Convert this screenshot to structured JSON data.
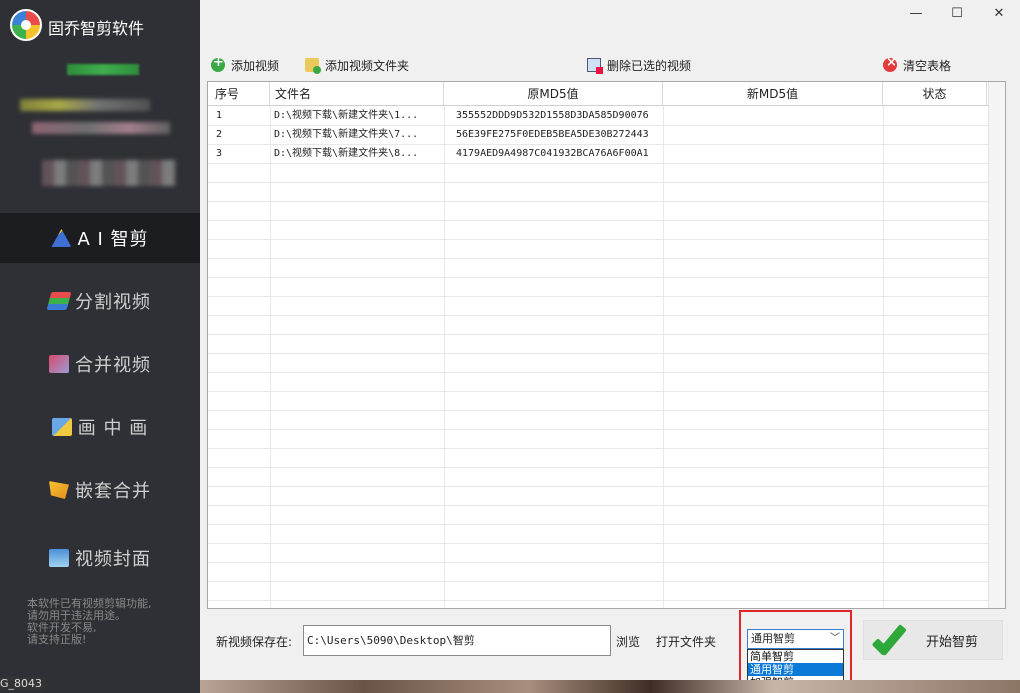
{
  "app": {
    "title": "固乔智剪软件"
  },
  "window_controls": {
    "minimize": "—",
    "maximize": "☐",
    "close": "✕"
  },
  "sidebar": {
    "items": [
      {
        "label": "A I 智剪",
        "icon": "ai-wand-icon",
        "active": true
      },
      {
        "label": "分割视频",
        "icon": "split-video-icon"
      },
      {
        "label": "合并视频",
        "icon": "merge-video-icon"
      },
      {
        "label": "画 中 画",
        "icon": "picture-in-picture-icon"
      },
      {
        "label": "嵌套合并",
        "icon": "nest-merge-icon"
      },
      {
        "label": "视频封面",
        "icon": "video-cover-icon"
      }
    ],
    "notice": "本软件已有视频剪辑功能,\n请勿用于违法用途。\n软件开发不易,\n请支持正版!",
    "corner_text": "G_8043"
  },
  "toolbar": {
    "add_video": "添加视频",
    "add_folder": "添加视频文件夹",
    "delete_selected": "删除已选的视频",
    "clear_table": "清空表格"
  },
  "table": {
    "columns": [
      "序号",
      "文件名",
      "原MD5值",
      "新MD5值",
      "状态"
    ],
    "rows": [
      {
        "index": "1",
        "file": "D:\\视频下载\\新建文件夹\\1...",
        "md5_old": "355552DDD9D532D1558D3DA585D90076",
        "md5_new": "",
        "status": ""
      },
      {
        "index": "2",
        "file": "D:\\视频下载\\新建文件夹\\7...",
        "md5_old": "56E39FE275F0EDEB5BEA5DE30B272443",
        "md5_new": "",
        "status": ""
      },
      {
        "index": "3",
        "file": "D:\\视频下载\\新建文件夹\\8...",
        "md5_old": "4179AED9A4987C041932BCA76A6F00A1",
        "md5_new": "",
        "status": ""
      }
    ]
  },
  "bottom": {
    "save_label": "新视频保存在:",
    "save_path": "C:\\Users\\5090\\Desktop\\智剪",
    "browse": "浏览",
    "open_folder": "打开文件夹",
    "mode_selected": "通用智剪",
    "mode_options": [
      "简单智剪",
      "通用智剪",
      "加强智剪"
    ],
    "start": "开始智剪"
  },
  "colors": {
    "sidebar_bg": "#2e3035",
    "active_bg": "#1c1d21",
    "highlight": "#e0262b",
    "select": "#0a79d8"
  }
}
